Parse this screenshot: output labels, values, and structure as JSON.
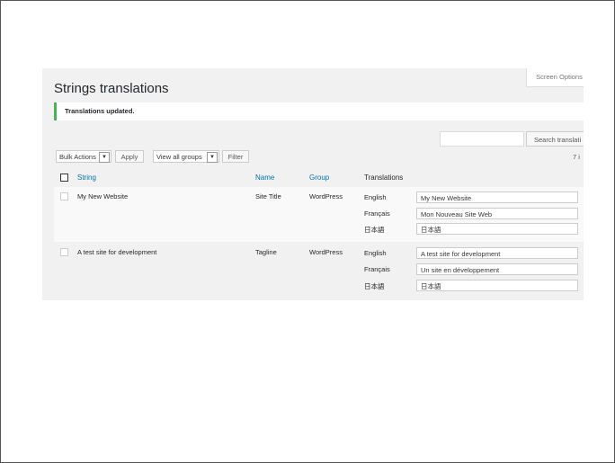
{
  "screen_options": "Screen Options",
  "page_title": "Strings translations",
  "notice": "Translations updated.",
  "search": {
    "button": "Search translati",
    "value": ""
  },
  "items_count": "7 i",
  "toolbar": {
    "bulk_actions": "Bulk Actions",
    "apply": "Apply",
    "groups_select": "View all groups",
    "filter": "Filter"
  },
  "columns": {
    "string": "String",
    "name": "Name",
    "group": "Group",
    "translations": "Translations"
  },
  "rows": [
    {
      "string": "My New Website",
      "name": "Site Title",
      "group": "WordPress",
      "translations": [
        {
          "lang": "English",
          "value": "My New Website"
        },
        {
          "lang": "Français",
          "value": "Mon Nouveau Site Web"
        },
        {
          "lang": "日本語",
          "value": "日本語"
        }
      ]
    },
    {
      "string": "A test site for development",
      "name": "Tagline",
      "group": "WordPress",
      "translations": [
        {
          "lang": "English",
          "value": "A test site for development"
        },
        {
          "lang": "Français",
          "value": "Un site en développement"
        },
        {
          "lang": "日本語",
          "value": "日本語"
        }
      ]
    }
  ]
}
